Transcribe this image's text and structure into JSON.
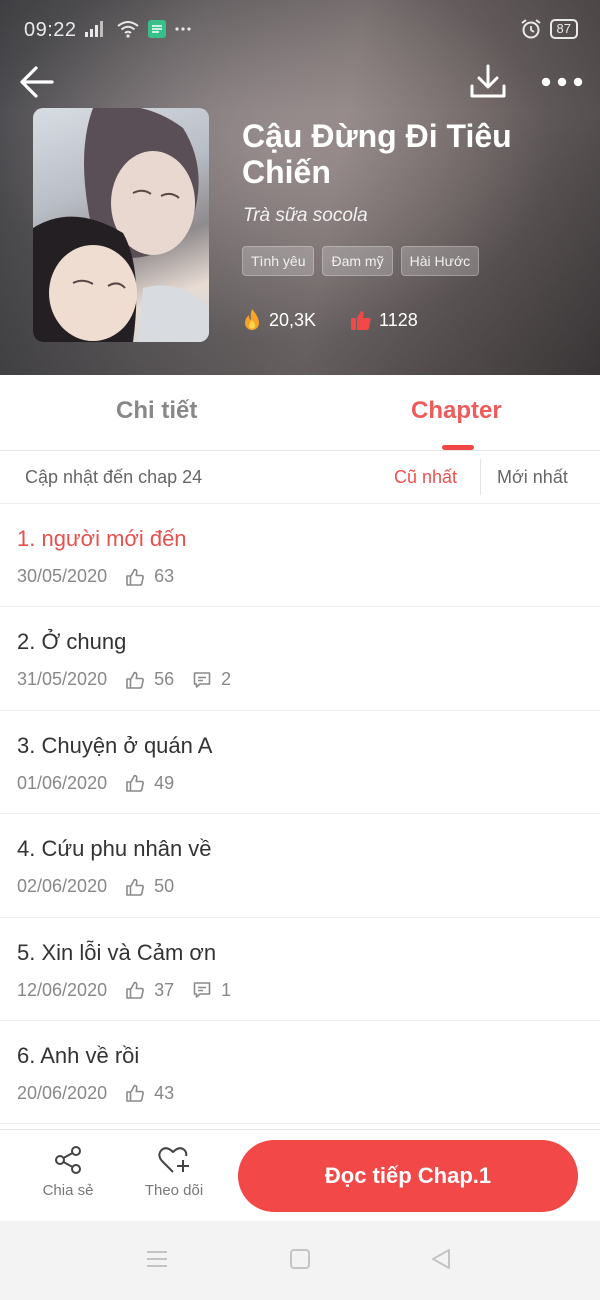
{
  "status_bar": {
    "time": "09:22",
    "battery": "87"
  },
  "book": {
    "title": "Cậu Đừng Đi Tiêu Chiến",
    "author": "Trà sữa socola",
    "tags": [
      "Tình yêu",
      "Đam mỹ",
      "Hài Hước"
    ],
    "views": "20,3K",
    "likes": "1128"
  },
  "tabs": {
    "detail": "Chi tiết",
    "chapter": "Chapter"
  },
  "sort": {
    "update_text": "Cập nhật đến chap 24",
    "oldest": "Cũ nhất",
    "newest": "Mới nhất"
  },
  "chapters": [
    {
      "title": "1. người mới đến",
      "date": "30/05/2020",
      "likes": "63",
      "comments": ""
    },
    {
      "title": "2. Ở chung",
      "date": "31/05/2020",
      "likes": "56",
      "comments": "2"
    },
    {
      "title": "3. Chuyện ở quán A",
      "date": "01/06/2020",
      "likes": "49",
      "comments": ""
    },
    {
      "title": "4. Cứu phu nhân về",
      "date": "02/06/2020",
      "likes": "50",
      "comments": ""
    },
    {
      "title": "5. Xin lỗi và Cảm ơn",
      "date": "12/06/2020",
      "likes": "37",
      "comments": "1"
    },
    {
      "title": "6. Anh về rồi",
      "date": "20/06/2020",
      "likes": "43",
      "comments": ""
    }
  ],
  "actions": {
    "share": "Chia sẻ",
    "follow": "Theo dõi",
    "read": "Đọc tiếp Chap.1"
  },
  "colors": {
    "accent": "#f34848",
    "accent_text": "#f05050"
  }
}
